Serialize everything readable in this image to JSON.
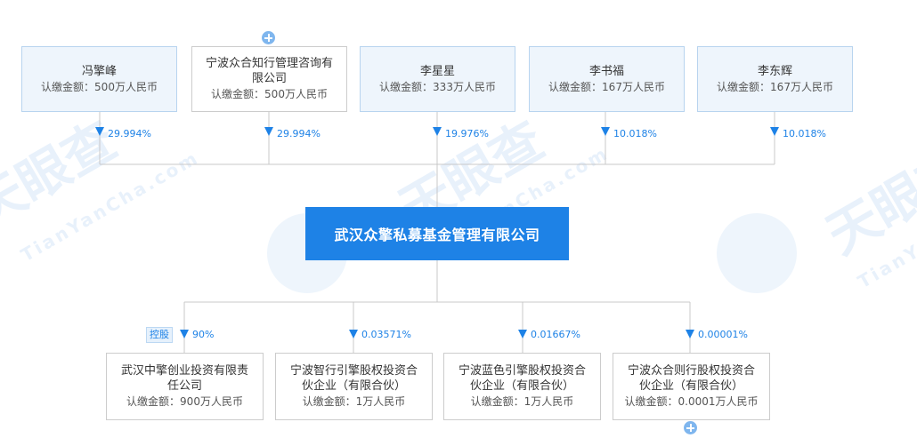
{
  "shareholders": [
    {
      "name": "冯擎峰",
      "amount": "认缴金额：500万人民币",
      "percent": "29.994%"
    },
    {
      "name": "宁波众合知行管理咨询有限公司",
      "amount": "认缴金额：500万人民币",
      "percent": "29.994%"
    },
    {
      "name": "李星星",
      "amount": "认缴金额：333万人民币",
      "percent": "19.976%"
    },
    {
      "name": "李书福",
      "amount": "认缴金额：167万人民币",
      "percent": "10.018%"
    },
    {
      "name": "李东辉",
      "amount": "认缴金额：167万人民币",
      "percent": "10.018%"
    }
  ],
  "company": {
    "name": "武汉众擎私募基金管理有限公司"
  },
  "investments": [
    {
      "name": "武汉中擎创业投资有限责任公司",
      "amount": "认缴金额：900万人民币",
      "percent": "90%",
      "badge": "控股"
    },
    {
      "name": "宁波智行引擎股权投资合伙企业（有限合伙）",
      "amount": "认缴金额：1万人民币",
      "percent": "0.03571%"
    },
    {
      "name": "宁波蓝色引擎股权投资合伙企业（有限合伙）",
      "amount": "认缴金额：1万人民币",
      "percent": "0.01667%"
    },
    {
      "name": "宁波众合则行股权投资合伙企业（有限合伙）",
      "amount": "认缴金额：0.0001万人民币",
      "percent": "0.00001%"
    }
  ],
  "watermark": {
    "brand": "天眼查",
    "url": "TianYanCha.com"
  }
}
